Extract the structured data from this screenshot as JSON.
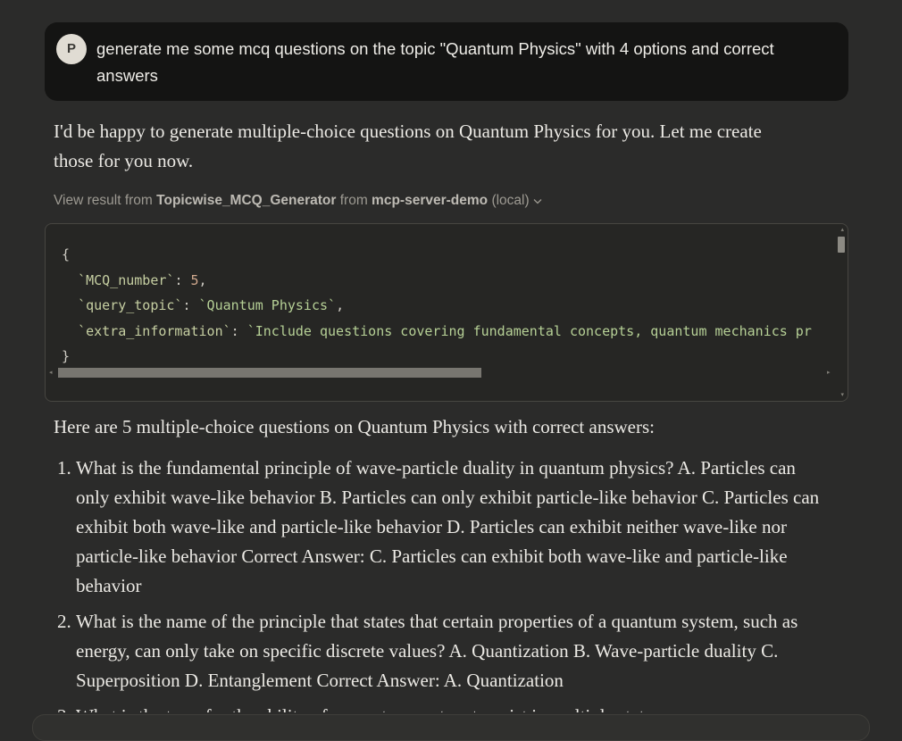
{
  "user_message": {
    "avatar_initial": "P",
    "text": "generate me some mcq questions on the topic \"Quantum Physics\" with 4 options and correct answers"
  },
  "assistant": {
    "intro": "I'd be happy to generate multiple-choice questions on Quantum Physics for you. Let me create those for you now.",
    "tool_call": {
      "prefix": "View result from",
      "tool_name": "Topicwise_MCQ_Generator",
      "from_word": "from",
      "server": "mcp-server-demo",
      "scope": "(local)",
      "expand_icon": "chevron-down-icon",
      "code": {
        "open_brace": "{",
        "lines": [
          {
            "key": "`MCQ_number`",
            "sep": ": ",
            "value": "5",
            "value_type": "number",
            "tail": ","
          },
          {
            "key": "`query_topic`",
            "sep": ": ",
            "value": "`Quantum Physics`",
            "value_type": "string",
            "tail": ","
          },
          {
            "key": "`extra_information`",
            "sep": ": ",
            "value": "`Include questions covering fundamental concepts, quantum mechanics pr",
            "value_type": "string",
            "tail": ""
          }
        ],
        "close_brace": "}"
      }
    },
    "answer_intro": "Here are 5 multiple-choice questions on Quantum Physics with correct answers:",
    "questions": [
      "What is the fundamental principle of wave-particle duality in quantum physics? A. Particles can only exhibit wave-like behavior B. Particles can only exhibit particle-like behavior C. Particles can exhibit both wave-like and particle-like behavior D. Particles can exhibit neither wave-like nor particle-like behavior Correct Answer: C. Particles can exhibit both wave-like and particle-like behavior",
      "What is the name of the principle that states that certain properties of a quantum system, such as energy, can only take on specific discrete values? A. Quantization B. Wave-particle duality C. Superposition D. Entanglement Correct Answer: A. Quantization",
      "What is the term for the ability of a quantum system to exist in multiple states"
    ]
  }
}
